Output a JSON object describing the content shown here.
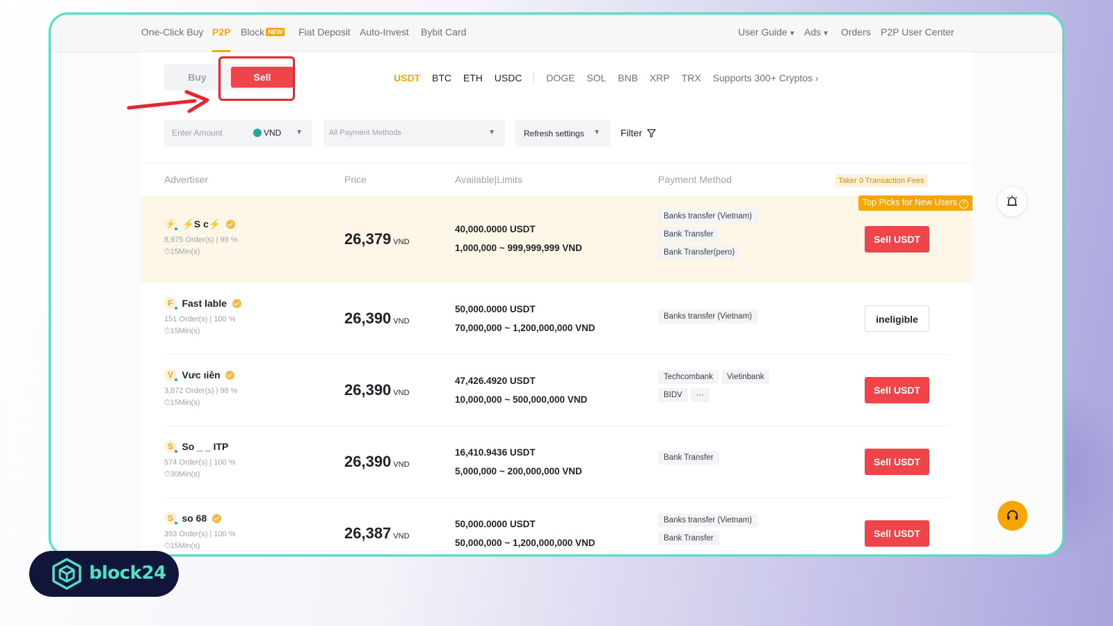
{
  "nav": {
    "left": [
      "One-Click Buy",
      "P2P",
      "Block",
      "Fiat Deposit",
      "Auto-Invest",
      "Bybit Card"
    ],
    "block_badge": "NEW",
    "right": [
      "User Guide",
      "Ads",
      "Orders",
      "P2P User Center"
    ]
  },
  "trade": {
    "buy_label": "Buy",
    "sell_label": "Sell",
    "coins": [
      "USDT",
      "BTC",
      "ETH",
      "USDC",
      "DOGE",
      "SOL",
      "BNB",
      "XRP",
      "TRX",
      "Supports 300+ Cryptos ›"
    ]
  },
  "filters": {
    "amount_placeholder": "Enter Amount",
    "currency": "VND",
    "payment_placeholder": "All Payment Methods",
    "refresh": "Refresh settings",
    "filter": "Filter"
  },
  "table": {
    "headers": [
      "Advertiser",
      "Price",
      "Available|Limits",
      "Payment Method"
    ],
    "taker_badge": "Taker 0 Transaction Fees",
    "top_picks": "Top Picks for New Users",
    "rows": [
      {
        "avatar": "⚡",
        "name": "⚡S       c⚡",
        "orders": "8,975 Order(s)  |  99 %",
        "time": "⏱15Min(s)",
        "price": "26,379",
        "unit": "VND",
        "available": "40,000.0000 USDT",
        "limits": "1,000,000 ~ 999,999,999 VND",
        "payments": [
          "Banks transfer (Vietnam)",
          "Bank Transfer",
          "Bank Transfer(pero)"
        ],
        "action": "Sell USDT"
      },
      {
        "avatar": "F",
        "name": "Fast       lable",
        "orders": "151 Order(s)  |  100 %",
        "time": "⏱15Min(s)",
        "price": "26,390",
        "unit": "VND",
        "available": "50,000.0000 USDT",
        "limits": "70,000,000 ~ 1,200,000,000 VND",
        "payments": [
          "Banks transfer (Vietnam)"
        ],
        "action": "ineligible"
      },
      {
        "avatar": "V",
        "name": "Vưc              ıiên",
        "orders": "3,872 Order(s)  |  98 %",
        "time": "⏱15Min(s)",
        "price": "26,390",
        "unit": "VND",
        "available": "47,426.4920 USDT",
        "limits": "10,000,000 ~ 500,000,000 VND",
        "payments": [
          "Techcombank",
          "Vietinbank",
          "BIDV",
          "···"
        ],
        "action": "Sell USDT"
      },
      {
        "avatar": "S",
        "name": "So        _ _  ITP",
        "orders": "574 Order(s)  |  100 %",
        "time": "⏱30Min(s)",
        "price": "26,390",
        "unit": "VND",
        "available": "16,410.9436 USDT",
        "limits": "5,000,000 ~ 200,000,000 VND",
        "payments": [
          "Bank Transfer"
        ],
        "action": "Sell USDT"
      },
      {
        "avatar": "S",
        "name": "so              68",
        "orders": "393 Order(s)  |  100 %",
        "time": "⏱15Min(s)",
        "price": "26,387",
        "unit": "VND",
        "available": "50,000.0000 USDT",
        "limits": "50,000,000 ~ 1,200,000,000 VND",
        "payments": [
          "Banks transfer (Vietnam)",
          "Bank Transfer"
        ],
        "action": "Sell USDT"
      }
    ]
  },
  "brand": {
    "name": "block24"
  },
  "icons": [
    "alarm-bell-icon",
    "support-headset-icon",
    "filter-funnel-icon",
    "red-arrow-pointer"
  ],
  "colors": {
    "accent": "#f7a600",
    "sell": "#ef454a",
    "frame": "#52e0c4",
    "brand_bg": "#12153a"
  }
}
